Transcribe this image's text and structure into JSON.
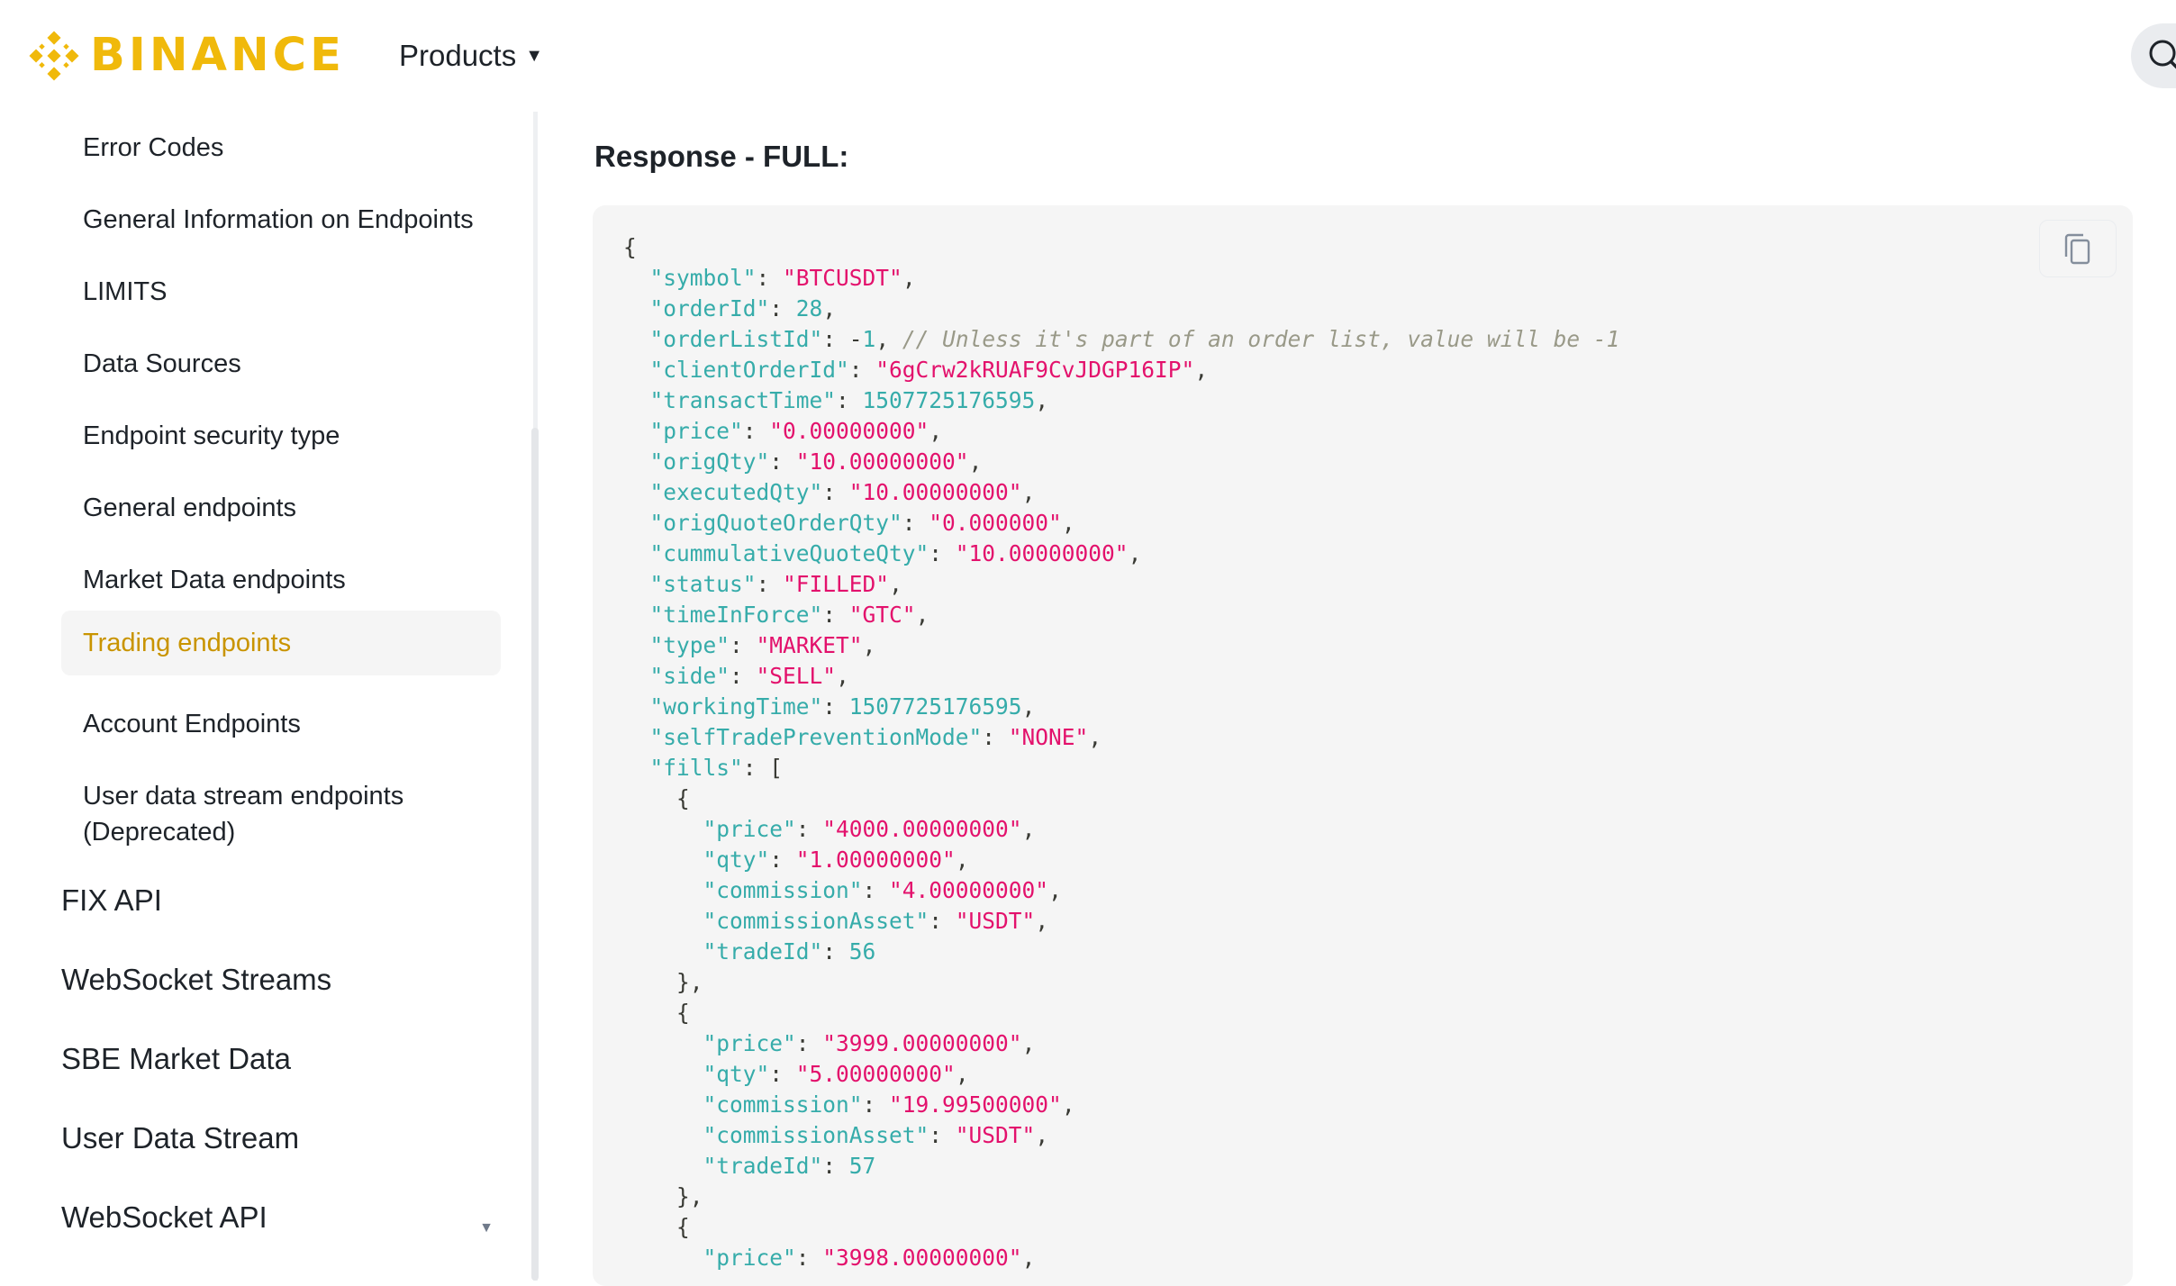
{
  "header": {
    "brand": "BINANCE",
    "products_label": "Products",
    "products_caret": "▼"
  },
  "sidebar": {
    "items": [
      {
        "label": "Error Codes",
        "active": false
      },
      {
        "label": "General Information on Endpoints",
        "active": false
      },
      {
        "label": "LIMITS",
        "active": false
      },
      {
        "label": "Data Sources",
        "active": false
      },
      {
        "label": "Endpoint security type",
        "active": false
      },
      {
        "label": "General endpoints",
        "active": false
      },
      {
        "label": "Market Data endpoints",
        "active": false
      },
      {
        "label": "Trading endpoints",
        "active": true
      },
      {
        "label": "Account Endpoints",
        "active": false
      },
      {
        "label": "User data stream endpoints",
        "active": false
      },
      {
        "label": "(Deprecated)",
        "active": false
      }
    ],
    "sections": [
      {
        "label": "FIX API"
      },
      {
        "label": "WebSocket Streams"
      },
      {
        "label": "SBE Market Data"
      },
      {
        "label": "User Data Stream"
      },
      {
        "label": "WebSocket API",
        "chevron": "▼"
      }
    ]
  },
  "main": {
    "title": "Response - FULL:",
    "code_lines": [
      [
        [
          "p",
          "{"
        ]
      ],
      [
        [
          "p",
          "  "
        ],
        [
          "k",
          "\"symbol\""
        ],
        [
          "p",
          ": "
        ],
        [
          "s",
          "\"BTCUSDT\""
        ],
        [
          "p",
          ","
        ]
      ],
      [
        [
          "p",
          "  "
        ],
        [
          "k",
          "\"orderId\""
        ],
        [
          "p",
          ": "
        ],
        [
          "n",
          "28"
        ],
        [
          "p",
          ","
        ]
      ],
      [
        [
          "p",
          "  "
        ],
        [
          "k",
          "\"orderListId\""
        ],
        [
          "p",
          ": -"
        ],
        [
          "n",
          "1"
        ],
        [
          "p",
          ", "
        ],
        [
          "c",
          "// Unless it's part of an order list, value will be -1"
        ]
      ],
      [
        [
          "p",
          "  "
        ],
        [
          "k",
          "\"clientOrderId\""
        ],
        [
          "p",
          ": "
        ],
        [
          "s",
          "\"6gCrw2kRUAF9CvJDGP16IP\""
        ],
        [
          "p",
          ","
        ]
      ],
      [
        [
          "p",
          "  "
        ],
        [
          "k",
          "\"transactTime\""
        ],
        [
          "p",
          ": "
        ],
        [
          "n",
          "1507725176595"
        ],
        [
          "p",
          ","
        ]
      ],
      [
        [
          "p",
          "  "
        ],
        [
          "k",
          "\"price\""
        ],
        [
          "p",
          ": "
        ],
        [
          "s",
          "\"0.00000000\""
        ],
        [
          "p",
          ","
        ]
      ],
      [
        [
          "p",
          "  "
        ],
        [
          "k",
          "\"origQty\""
        ],
        [
          "p",
          ": "
        ],
        [
          "s",
          "\"10.00000000\""
        ],
        [
          "p",
          ","
        ]
      ],
      [
        [
          "p",
          "  "
        ],
        [
          "k",
          "\"executedQty\""
        ],
        [
          "p",
          ": "
        ],
        [
          "s",
          "\"10.00000000\""
        ],
        [
          "p",
          ","
        ]
      ],
      [
        [
          "p",
          "  "
        ],
        [
          "k",
          "\"origQuoteOrderQty\""
        ],
        [
          "p",
          ": "
        ],
        [
          "s",
          "\"0.000000\""
        ],
        [
          "p",
          ","
        ]
      ],
      [
        [
          "p",
          "  "
        ],
        [
          "k",
          "\"cummulativeQuoteQty\""
        ],
        [
          "p",
          ": "
        ],
        [
          "s",
          "\"10.00000000\""
        ],
        [
          "p",
          ","
        ]
      ],
      [
        [
          "p",
          "  "
        ],
        [
          "k",
          "\"status\""
        ],
        [
          "p",
          ": "
        ],
        [
          "s",
          "\"FILLED\""
        ],
        [
          "p",
          ","
        ]
      ],
      [
        [
          "p",
          "  "
        ],
        [
          "k",
          "\"timeInForce\""
        ],
        [
          "p",
          ": "
        ],
        [
          "s",
          "\"GTC\""
        ],
        [
          "p",
          ","
        ]
      ],
      [
        [
          "p",
          "  "
        ],
        [
          "k",
          "\"type\""
        ],
        [
          "p",
          ": "
        ],
        [
          "s",
          "\"MARKET\""
        ],
        [
          "p",
          ","
        ]
      ],
      [
        [
          "p",
          "  "
        ],
        [
          "k",
          "\"side\""
        ],
        [
          "p",
          ": "
        ],
        [
          "s",
          "\"SELL\""
        ],
        [
          "p",
          ","
        ]
      ],
      [
        [
          "p",
          "  "
        ],
        [
          "k",
          "\"workingTime\""
        ],
        [
          "p",
          ": "
        ],
        [
          "n",
          "1507725176595"
        ],
        [
          "p",
          ","
        ]
      ],
      [
        [
          "p",
          "  "
        ],
        [
          "k",
          "\"selfTradePreventionMode\""
        ],
        [
          "p",
          ": "
        ],
        [
          "s",
          "\"NONE\""
        ],
        [
          "p",
          ","
        ]
      ],
      [
        [
          "p",
          "  "
        ],
        [
          "k",
          "\"fills\""
        ],
        [
          "p",
          ": ["
        ]
      ],
      [
        [
          "p",
          "    {"
        ]
      ],
      [
        [
          "p",
          "      "
        ],
        [
          "k",
          "\"price\""
        ],
        [
          "p",
          ": "
        ],
        [
          "s",
          "\"4000.00000000\""
        ],
        [
          "p",
          ","
        ]
      ],
      [
        [
          "p",
          "      "
        ],
        [
          "k",
          "\"qty\""
        ],
        [
          "p",
          ": "
        ],
        [
          "s",
          "\"1.00000000\""
        ],
        [
          "p",
          ","
        ]
      ],
      [
        [
          "p",
          "      "
        ],
        [
          "k",
          "\"commission\""
        ],
        [
          "p",
          ": "
        ],
        [
          "s",
          "\"4.00000000\""
        ],
        [
          "p",
          ","
        ]
      ],
      [
        [
          "p",
          "      "
        ],
        [
          "k",
          "\"commissionAsset\""
        ],
        [
          "p",
          ": "
        ],
        [
          "s",
          "\"USDT\""
        ],
        [
          "p",
          ","
        ]
      ],
      [
        [
          "p",
          "      "
        ],
        [
          "k",
          "\"tradeId\""
        ],
        [
          "p",
          ": "
        ],
        [
          "n",
          "56"
        ]
      ],
      [
        [
          "p",
          "    },"
        ]
      ],
      [
        [
          "p",
          "    {"
        ]
      ],
      [
        [
          "p",
          "      "
        ],
        [
          "k",
          "\"price\""
        ],
        [
          "p",
          ": "
        ],
        [
          "s",
          "\"3999.00000000\""
        ],
        [
          "p",
          ","
        ]
      ],
      [
        [
          "p",
          "      "
        ],
        [
          "k",
          "\"qty\""
        ],
        [
          "p",
          ": "
        ],
        [
          "s",
          "\"5.00000000\""
        ],
        [
          "p",
          ","
        ]
      ],
      [
        [
          "p",
          "      "
        ],
        [
          "k",
          "\"commission\""
        ],
        [
          "p",
          ": "
        ],
        [
          "s",
          "\"19.99500000\""
        ],
        [
          "p",
          ","
        ]
      ],
      [
        [
          "p",
          "      "
        ],
        [
          "k",
          "\"commissionAsset\""
        ],
        [
          "p",
          ": "
        ],
        [
          "s",
          "\"USDT\""
        ],
        [
          "p",
          ","
        ]
      ],
      [
        [
          "p",
          "      "
        ],
        [
          "k",
          "\"tradeId\""
        ],
        [
          "p",
          ": "
        ],
        [
          "n",
          "57"
        ]
      ],
      [
        [
          "p",
          "    },"
        ]
      ],
      [
        [
          "p",
          "    {"
        ]
      ],
      [
        [
          "p",
          "      "
        ],
        [
          "k",
          "\"price\""
        ],
        [
          "p",
          ": "
        ],
        [
          "s",
          "\"3998.00000000\""
        ],
        [
          "p",
          ","
        ]
      ]
    ]
  },
  "colors": {
    "brand": "#F0B90B",
    "active_text": "#C99400",
    "code_key": "#36ACAA",
    "code_string": "#E3116C",
    "code_comment": "#999988"
  }
}
